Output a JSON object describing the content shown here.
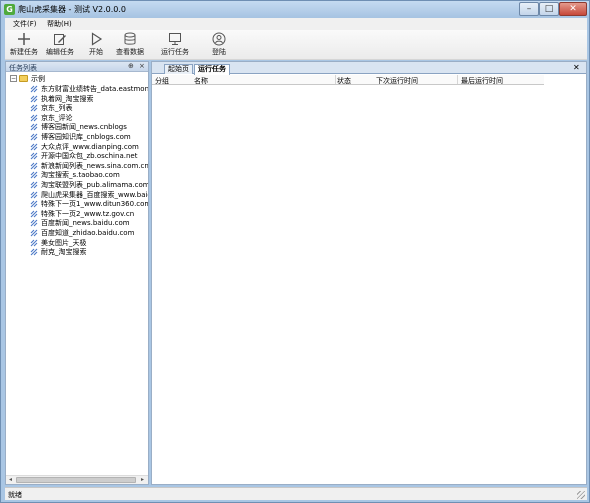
{
  "window": {
    "title": "爬山虎采集器 - 测试 V2.0.0.0",
    "app_icon_glyph": "G",
    "minimize_glyph": "–",
    "maximize_glyph": "□",
    "close_glyph": "✕"
  },
  "menu": {
    "items": [
      "文件(F)",
      "帮助(H)"
    ]
  },
  "toolbar": {
    "buttons": [
      {
        "label": "新建任务",
        "icon": "plus-icon"
      },
      {
        "label": "编辑任务",
        "icon": "edit-icon"
      },
      {
        "label": "开始",
        "icon": "play-icon"
      },
      {
        "label": "查看数据",
        "icon": "database-icon"
      },
      {
        "label": "运行任务",
        "icon": "monitor-icon"
      },
      {
        "label": "登陆",
        "icon": "user-icon"
      }
    ]
  },
  "task_panel": {
    "title": "任务列表",
    "pin_glyph": "⊕",
    "close_glyph": "×",
    "root": {
      "label": "示例",
      "expander": "−",
      "icon": "folder-icon"
    },
    "items": [
      "东方财富业绩转告_data.eastmoney",
      "执着网_淘宝搜索",
      "京东_列表",
      "京东_评论",
      "博客园新闻_news.cnblogs",
      "博客园知识库_cnblogs.com",
      "大众点评_www.dianping.com",
      "开源中国众包_zb.oschina.net",
      "新浪新闻列表_news.sina.com.cn",
      "淘宝搜索_s.taobao.com",
      "淘宝联盟列表_pub.alimama.com",
      "爬山虎采集器_百度搜索_www.baidu",
      "特殊下一页1_www.ditun360.com",
      "特殊下一页2_www.tz.gov.cn",
      "百度新闻_news.baidu.com",
      "百度知道_zhidao.baidu.com",
      "美女图片_天极",
      "耐克_淘宝搜索"
    ],
    "scroll_left": "◂",
    "scroll_right": "▸"
  },
  "main": {
    "tabs": [
      {
        "label": "起始页",
        "active": false
      },
      {
        "label": "运行任务",
        "active": true
      }
    ],
    "close_glyph": "✕",
    "columns": [
      "分组",
      "名称",
      "状态",
      "下次运行时间",
      "最后运行时间"
    ]
  },
  "status": {
    "text": "就绪"
  },
  "colors": {
    "frame": "#a9c6e4",
    "panel_header": "#c6d6ea",
    "folder": "#f3cf5c",
    "leaf_icon": "#4a78c6"
  }
}
